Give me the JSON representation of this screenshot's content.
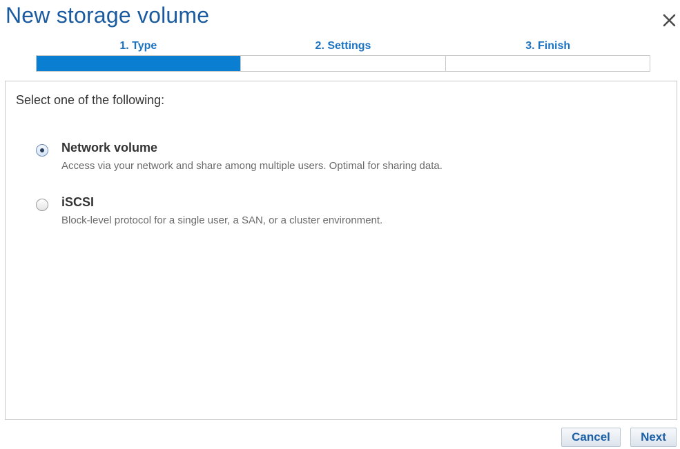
{
  "dialog": {
    "title": "New storage volume"
  },
  "wizard": {
    "steps": [
      {
        "label": "1. Type",
        "complete": true
      },
      {
        "label": "2. Settings",
        "complete": false
      },
      {
        "label": "3. Finish",
        "complete": false
      }
    ],
    "progress_fraction": 0.3333
  },
  "content": {
    "prompt": "Select one of the following:",
    "options": [
      {
        "title": "Network volume",
        "description": "Access via your network and share among multiple users. Optimal for sharing data.",
        "selected": true
      },
      {
        "title": "iSCSI",
        "description": "Block-level protocol for a single user, a SAN, or a cluster environment.",
        "selected": false
      }
    ]
  },
  "footer": {
    "cancel_label": "Cancel",
    "next_label": "Next"
  },
  "colors": {
    "title": "#1a5a9e",
    "progress_fill": "#0a7fd2",
    "step_label": "#1a73c2"
  },
  "icons": {
    "close": "close-icon"
  }
}
